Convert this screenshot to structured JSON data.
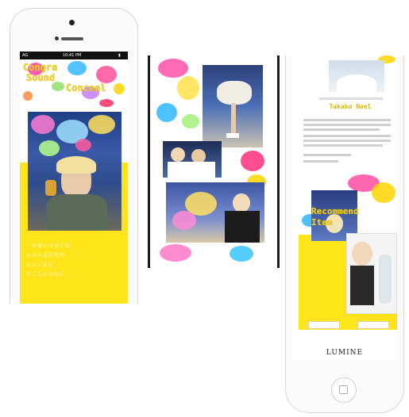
{
  "screen1": {
    "status": {
      "carrier": "AG",
      "time": "10:41 PM",
      "battery": "▮"
    },
    "title_lines": [
      "Congra",
      "Sound",
      "Conceal"
    ],
    "caption_lines": [
      "　お祝いの色と音",
      "あふれる日常の",
      "ひとこまを",
      "すこしだけ色に"
    ]
  },
  "screen3": {
    "artist_name": "Takako Noel",
    "recommend_lines": [
      "Recommend",
      "Item"
    ],
    "buttons": [
      "",
      ""
    ],
    "logo": "LUMINE"
  }
}
